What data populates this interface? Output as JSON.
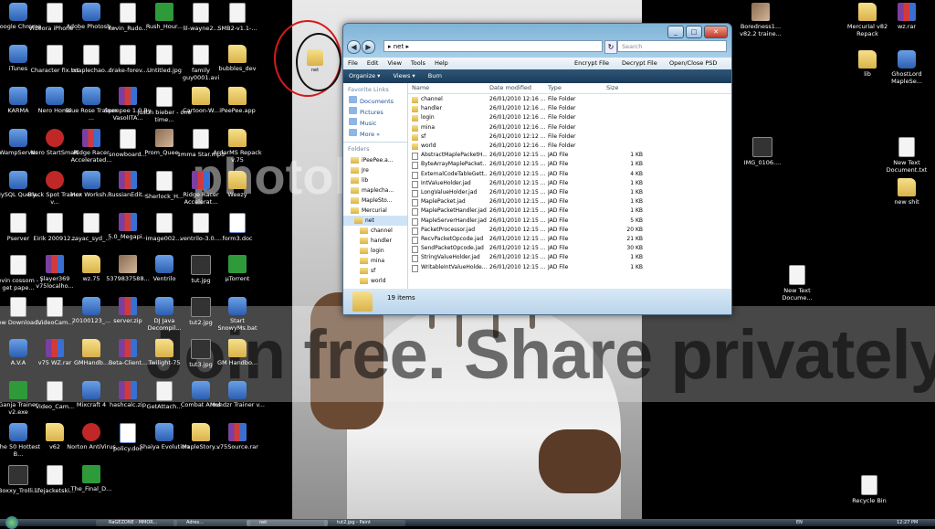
{
  "desktop_icons": [
    {
      "label": "Google Chrome",
      "glyph": "app"
    },
    {
      "label": "Videora iPhone ...",
      "glyph": "file"
    },
    {
      "label": "Adobe Photosh...",
      "glyph": "app"
    },
    {
      "label": "Kevin_Rudo...",
      "glyph": "file"
    },
    {
      "label": "Rush_Hour...",
      "glyph": "green"
    },
    {
      "label": "lil-wayne2...",
      "glyph": "file"
    },
    {
      "label": "SMB2-v1.1-...",
      "glyph": "file"
    },
    {
      "label": "iTunes",
      "glyph": "app"
    },
    {
      "label": "Character fix.txt",
      "glyph": "file"
    },
    {
      "label": "maplechao...",
      "glyph": "file"
    },
    {
      "label": "drake-forev...",
      "glyph": "file"
    },
    {
      "label": "Untitled.jpg",
      "glyph": "file"
    },
    {
      "label": "family guy0001.avi",
      "glyph": "file"
    },
    {
      "label": "bubbles_dev",
      "glyph": "folder"
    },
    {
      "label": "KARMA",
      "glyph": "app"
    },
    {
      "label": "Nero Home",
      "glyph": "app"
    },
    {
      "label": "Blue Rose Trainer ...",
      "glyph": "app"
    },
    {
      "label": "Speepee 1.0 By VasolITA...",
      "glyph": "rar"
    },
    {
      "label": "justin bieber - one time...",
      "glyph": "file"
    },
    {
      "label": "Cartoon-W...",
      "glyph": "folder"
    },
    {
      "label": "iPeePee.app",
      "glyph": "folder"
    },
    {
      "label": "WampServer",
      "glyph": "app"
    },
    {
      "label": "Nero StartSmart",
      "glyph": "red"
    },
    {
      "label": "Ridge Racer Accelerated...",
      "glyph": "rar"
    },
    {
      "label": "snowboard...",
      "glyph": "file"
    },
    {
      "label": "Prom_Quee...",
      "glyph": "photo"
    },
    {
      "label": "1mma Star.mp3",
      "glyph": "file"
    },
    {
      "label": "ArdarMS Repack v.75",
      "glyph": "folder"
    },
    {
      "label": "MySQL Query...",
      "glyph": "app"
    },
    {
      "label": "Black Spot Trainer v...",
      "glyph": "red"
    },
    {
      "label": "Hex Worksh...",
      "glyph": "app"
    },
    {
      "label": "RussianEdit...",
      "glyph": "rar"
    },
    {
      "label": "Sherlock_H...",
      "glyph": "file"
    },
    {
      "label": "Ridge Racer Accelerat...",
      "glyph": "rar"
    },
    {
      "label": "Weezy",
      "glyph": "folder"
    },
    {
      "label": "Pserver",
      "glyph": "file"
    },
    {
      "label": "Eirik 200912...",
      "glyph": "file"
    },
    {
      "label": "zayac_syd_...",
      "glyph": "file"
    },
    {
      "label": "5.0_Megapi...",
      "glyph": "rar"
    },
    {
      "label": "image002....",
      "glyph": "file"
    },
    {
      "label": "ventrilo-3.0....",
      "glyph": "file"
    },
    {
      "label": "form3.doc",
      "glyph": "doc"
    },
    {
      "label": "kevin cossom - i get pape...",
      "glyph": "file"
    },
    {
      "label": "Slayer369 v75localho...",
      "glyph": "rar"
    },
    {
      "label": "wz.75",
      "glyph": "folder"
    },
    {
      "label": "5379837588...",
      "glyph": "photo"
    },
    {
      "label": "Ventrilo",
      "glyph": "app"
    },
    {
      "label": "tut.jpg",
      "glyph": "dark"
    },
    {
      "label": "µTorrent",
      "glyph": "green"
    },
    {
      "label": "New Download...",
      "glyph": "file"
    },
    {
      "label": "iVideoCam...",
      "glyph": "file"
    },
    {
      "label": "20100123_...",
      "glyph": "app"
    },
    {
      "label": "server.zip",
      "glyph": "rar"
    },
    {
      "label": "DJ Java Decompil...",
      "glyph": "app"
    },
    {
      "label": "tut2.jpg",
      "glyph": "dark"
    },
    {
      "label": "Start SnowyMs.bat",
      "glyph": "app"
    },
    {
      "label": "A.V.A",
      "glyph": "app"
    },
    {
      "label": "v75 WZ.rar",
      "glyph": "rar"
    },
    {
      "label": "GMHandb...",
      "glyph": "folder"
    },
    {
      "label": "Beta-Client...",
      "glyph": "rar"
    },
    {
      "label": "Twilight-75",
      "glyph": "folder"
    },
    {
      "label": "tut3.jpg",
      "glyph": "dark"
    },
    {
      "label": "GM Handbo...",
      "glyph": "folder"
    },
    {
      "label": "Ganja Trainer v2.exe",
      "glyph": "green"
    },
    {
      "label": "Video_Cam...",
      "glyph": "file"
    },
    {
      "label": "Mixcraft 4",
      "glyph": "app"
    },
    {
      "label": "hashcalc.zip",
      "glyph": "rar"
    },
    {
      "label": "GetAttach...",
      "glyph": "file"
    },
    {
      "label": "Combat Arms",
      "glyph": "app"
    },
    {
      "label": "Muhdzr Trainer v...",
      "glyph": "app"
    },
    {
      "label": "The 50 Hottest B...",
      "glyph": "app"
    },
    {
      "label": "v62",
      "glyph": "folder"
    },
    {
      "label": "Norton AntiVirus",
      "glyph": "red"
    },
    {
      "label": "policy.doc",
      "glyph": "doc"
    },
    {
      "label": "Shaiya Evolution",
      "glyph": "app"
    },
    {
      "label": "MapleStory...",
      "glyph": "folder"
    },
    {
      "label": "v75Source.rar",
      "glyph": "rar"
    },
    {
      "label": "Boxxy_Trolli...",
      "glyph": "dark"
    },
    {
      "label": "lifejacketski...",
      "glyph": "file"
    },
    {
      "label": "The_Final_D...",
      "glyph": "green"
    }
  ],
  "right_icons": [
    {
      "label": "Boredness1... v82.2 traine...",
      "glyph": "photo"
    },
    {
      "label": "Mercurial v82 Repack",
      "glyph": "folder"
    },
    {
      "label": "wz.rar",
      "glyph": "rar"
    },
    {
      "label": "lib",
      "glyph": "folder"
    },
    {
      "label": "GhostLord MapleSe...",
      "glyph": "app"
    },
    {
      "label": "IMG_0106....",
      "glyph": "dark"
    },
    {
      "label": "New Text Document.txt",
      "glyph": "file"
    },
    {
      "label": "new shit",
      "glyph": "folder"
    },
    {
      "label": "New Text Docume...",
      "glyph": "file"
    },
    {
      "label": "Recycle Bin",
      "glyph": "file"
    }
  ],
  "watermark": {
    "text": "Join free. Share privately.",
    "logo": "photobucket"
  },
  "annotation_folder_label": "net",
  "explorer": {
    "address": "▸ net ▸",
    "search_placeholder": "Search",
    "menu": [
      "File",
      "Edit",
      "View",
      "Tools",
      "Help"
    ],
    "menu_actions": [
      "Encrypt File",
      "Decrypt File",
      "Open/Close PSD"
    ],
    "toolbar": [
      "Organize ▾",
      "Views ▾",
      "Burn"
    ],
    "favorite_links_header": "Favorite Links",
    "favorites": [
      "Documents",
      "Pictures",
      "Music"
    ],
    "more": "More »",
    "folders_header": "Folders",
    "tree": [
      "iPeePee.a...",
      "Jre",
      "lib",
      "maplecha...",
      "MapleSto...",
      "Mercurial",
      "net",
      "channel",
      "handler",
      "login",
      "mina",
      "sf",
      "world"
    ],
    "columns": [
      "Name",
      "Date modified",
      "Type",
      "Size"
    ],
    "rows": [
      {
        "name": "channel",
        "date": "26/01/2010 12:16 ...",
        "type": "File Folder",
        "size": "",
        "kind": "folder"
      },
      {
        "name": "handler",
        "date": "26/01/2010 12:16 ...",
        "type": "File Folder",
        "size": "",
        "kind": "folder"
      },
      {
        "name": "login",
        "date": "26/01/2010 12:16 ...",
        "type": "File Folder",
        "size": "",
        "kind": "folder"
      },
      {
        "name": "mina",
        "date": "26/01/2010 12:16 ...",
        "type": "File Folder",
        "size": "",
        "kind": "folder"
      },
      {
        "name": "sf",
        "date": "26/01/2010 12:12 ...",
        "type": "File Folder",
        "size": "",
        "kind": "folder"
      },
      {
        "name": "world",
        "date": "26/01/2010 12:16 ...",
        "type": "File Folder",
        "size": "",
        "kind": "folder"
      },
      {
        "name": "AbstractMaplePacketH...",
        "date": "26/01/2010 12:15 ...",
        "type": "JAD File",
        "size": "1 KB",
        "kind": "file"
      },
      {
        "name": "ByteArrayMaplePacket...",
        "date": "26/01/2010 12:15 ...",
        "type": "JAD File",
        "size": "1 KB",
        "kind": "file"
      },
      {
        "name": "ExternalCodeTableGett...",
        "date": "26/01/2010 12:15 ...",
        "type": "JAD File",
        "size": "4 KB",
        "kind": "file"
      },
      {
        "name": "IntValueHolder.jad",
        "date": "26/01/2010 12:15 ...",
        "type": "JAD File",
        "size": "1 KB",
        "kind": "file"
      },
      {
        "name": "LongValueHolder.jad",
        "date": "26/01/2010 12:15 ...",
        "type": "JAD File",
        "size": "1 KB",
        "kind": "file"
      },
      {
        "name": "MaplePacket.jad",
        "date": "26/01/2010 12:15 ...",
        "type": "JAD File",
        "size": "1 KB",
        "kind": "file"
      },
      {
        "name": "MaplePacketHandler.jad",
        "date": "26/01/2010 12:15 ...",
        "type": "JAD File",
        "size": "1 KB",
        "kind": "file"
      },
      {
        "name": "MapleServerHandler.jad",
        "date": "26/01/2010 12:15 ...",
        "type": "JAD File",
        "size": "5 KB",
        "kind": "file"
      },
      {
        "name": "PacketProcessor.jad",
        "date": "26/01/2010 12:15 ...",
        "type": "JAD File",
        "size": "20 KB",
        "kind": "file"
      },
      {
        "name": "RecvPacketOpcode.jad",
        "date": "26/01/2010 12:15 ...",
        "type": "JAD File",
        "size": "21 KB",
        "kind": "file"
      },
      {
        "name": "SendPacketOpcode.jad",
        "date": "26/01/2010 12:15 ...",
        "type": "JAD File",
        "size": "30 KB",
        "kind": "file"
      },
      {
        "name": "StringValueHolder.jad",
        "date": "26/01/2010 12:15 ...",
        "type": "JAD File",
        "size": "1 KB",
        "kind": "file"
      },
      {
        "name": "WritableIntValueHolde...",
        "date": "26/01/2010 12:15 ...",
        "type": "JAD File",
        "size": "1 KB",
        "kind": "file"
      }
    ],
    "status": "19 items"
  },
  "taskbar": {
    "tasks": [
      "RaGEZONE - MMOR...",
      "Adres...",
      "net",
      "tut2.jpg - Paint"
    ],
    "locale": "EN",
    "clock": "12:27 PM"
  }
}
